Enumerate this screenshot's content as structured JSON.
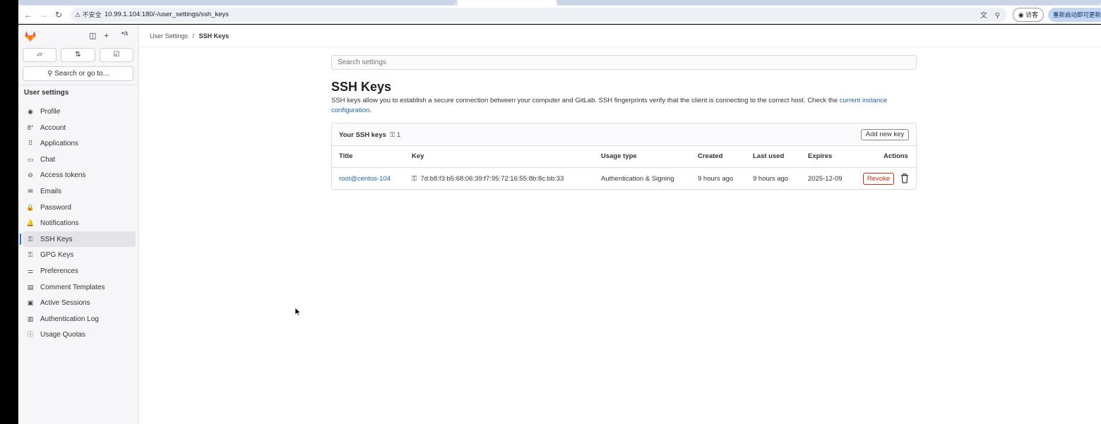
{
  "browser": {
    "security_label": "不安全",
    "url": "10.99.1.104:180/-/user_settings/ssh_keys",
    "guest_label": "访客",
    "update_label": "重新启动即可更新"
  },
  "sidebar": {
    "avatar_alt": "a",
    "search_label": "Search or go to...",
    "heading": "User settings",
    "items": [
      {
        "label": "Profile",
        "icon": "profile-icon",
        "glyph": "◉"
      },
      {
        "label": "Account",
        "icon": "account-icon",
        "glyph": "8°"
      },
      {
        "label": "Applications",
        "icon": "applications-icon",
        "glyph": "⠿"
      },
      {
        "label": "Chat",
        "icon": "chat-icon",
        "glyph": "▭"
      },
      {
        "label": "Access tokens",
        "icon": "token-icon",
        "glyph": "⊖"
      },
      {
        "label": "Emails",
        "icon": "email-icon",
        "glyph": "✉"
      },
      {
        "label": "Password",
        "icon": "lock-icon",
        "glyph": "🔒"
      },
      {
        "label": "Notifications",
        "icon": "bell-icon",
        "glyph": "🔔"
      },
      {
        "label": "SSH Keys",
        "icon": "key-icon",
        "glyph": "⚿",
        "active": true
      },
      {
        "label": "GPG Keys",
        "icon": "key-icon",
        "glyph": "⚿"
      },
      {
        "label": "Preferences",
        "icon": "preferences-icon",
        "glyph": "⚌"
      },
      {
        "label": "Comment Templates",
        "icon": "comment-icon",
        "glyph": "▤"
      },
      {
        "label": "Active Sessions",
        "icon": "monitor-icon",
        "glyph": "▣"
      },
      {
        "label": "Authentication Log",
        "icon": "log-icon",
        "glyph": "▥"
      },
      {
        "label": "Usage Quotas",
        "icon": "quota-icon",
        "glyph": "ⓘ"
      }
    ]
  },
  "breadcrumb": {
    "parent": "User Settings",
    "separator": "/",
    "current": "SSH Keys"
  },
  "main": {
    "search_placeholder": "Search settings",
    "title": "SSH Keys",
    "description": "SSH keys allow you to establish a secure connection between your computer and GitLab. SSH fingerprints verify that the client is connecting to the correct host. Check the",
    "description_link": "current instance configuration",
    "description_end": ".",
    "card": {
      "title": "Your SSH keys",
      "count": "1",
      "add_button": "Add new key",
      "columns": [
        "Title",
        "Key",
        "Usage type",
        "Created",
        "Last used",
        "Expires",
        "Actions"
      ],
      "rows": [
        {
          "title": "root@centos-104",
          "key": "7d:b8:f3:b5:68:06:39:f7:95:72:16:55:8b:8c:bb:33",
          "usage": "Authentication & Signing",
          "created": "9 hours ago",
          "last_used": "9 hours ago",
          "expires": "2025-12-09",
          "revoke": "Revoke"
        }
      ]
    }
  },
  "colors": {
    "accent": "#1f75cb",
    "link": "#1f63b6",
    "danger": "#dd2b0e",
    "gitlab_orange": "#e24329"
  }
}
